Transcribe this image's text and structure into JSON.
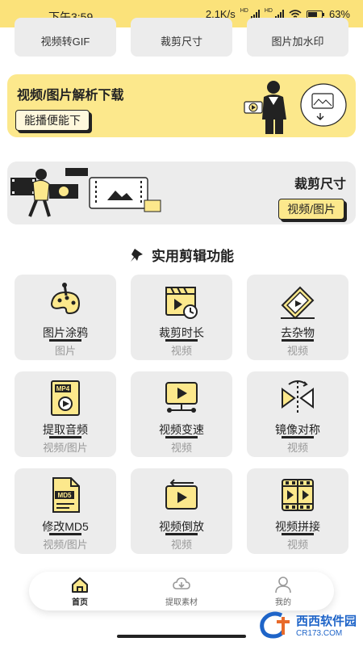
{
  "status_bar": {
    "time": "下午3:59",
    "network_speed": "2.1K/s",
    "battery": "63%"
  },
  "top_cards": [
    "视频转GIF",
    "裁剪尺寸",
    "图片加水印"
  ],
  "banner1": {
    "title": "视频/图片解析下载",
    "button": "能播便能下"
  },
  "banner2": {
    "title": "裁剪尺寸",
    "button": "视频/图片"
  },
  "section": {
    "title": "实用剪辑功能"
  },
  "tools": [
    {
      "name": "图片涂鸦",
      "tag": "图片",
      "icon": "palette-icon"
    },
    {
      "name": "裁剪时长",
      "tag": "视频",
      "icon": "clapperboard-clock-icon"
    },
    {
      "name": "去杂物",
      "tag": "视频",
      "icon": "eraser-icon"
    },
    {
      "name": "提取音频",
      "tag": "视频/图片",
      "icon": "mp4-file-icon"
    },
    {
      "name": "视频变速",
      "tag": "视频",
      "icon": "monitor-play-icon"
    },
    {
      "name": "镜像对称",
      "tag": "视频",
      "icon": "mirror-icon"
    },
    {
      "name": "修改MD5",
      "tag": "视频/图片",
      "icon": "md5-file-icon"
    },
    {
      "name": "视频倒放",
      "tag": "视频",
      "icon": "rewind-screen-icon"
    },
    {
      "name": "视频拼接",
      "tag": "视频",
      "icon": "film-strip-icon"
    }
  ],
  "tabs": [
    {
      "label": "首页",
      "icon": "home-icon",
      "active": true
    },
    {
      "label": "提取素材",
      "icon": "download-cloud-icon",
      "active": false
    },
    {
      "label": "我的",
      "icon": "user-icon",
      "active": false
    }
  ],
  "watermark": {
    "title": "西西软件园",
    "site": "CR173.COM"
  },
  "colors": {
    "accent": "#fce88c",
    "tile_bg": "#ececec",
    "tag_text": "#999999",
    "watermark": "#1e64c8"
  }
}
